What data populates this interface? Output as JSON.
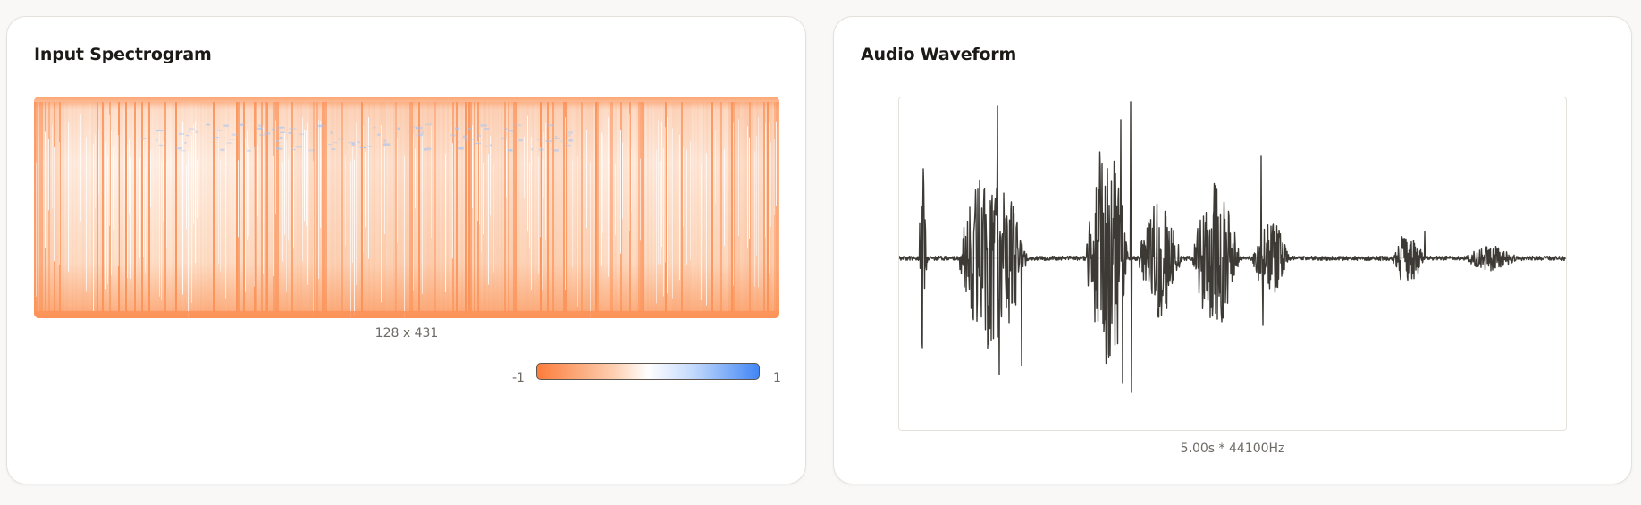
{
  "spectrogram_panel": {
    "title": "Input Spectrogram",
    "dimensions_label": "128 x 431",
    "scale_min_label": "-1",
    "scale_max_label": "1",
    "colormap": {
      "negative": "#fb7d3c",
      "zero": "#ffffff",
      "positive": "#4286f5"
    }
  },
  "waveform_panel": {
    "title": "Audio Waveform",
    "meta_label": "5.00s * 44100Hz",
    "line_color": "#3d3a35"
  }
}
